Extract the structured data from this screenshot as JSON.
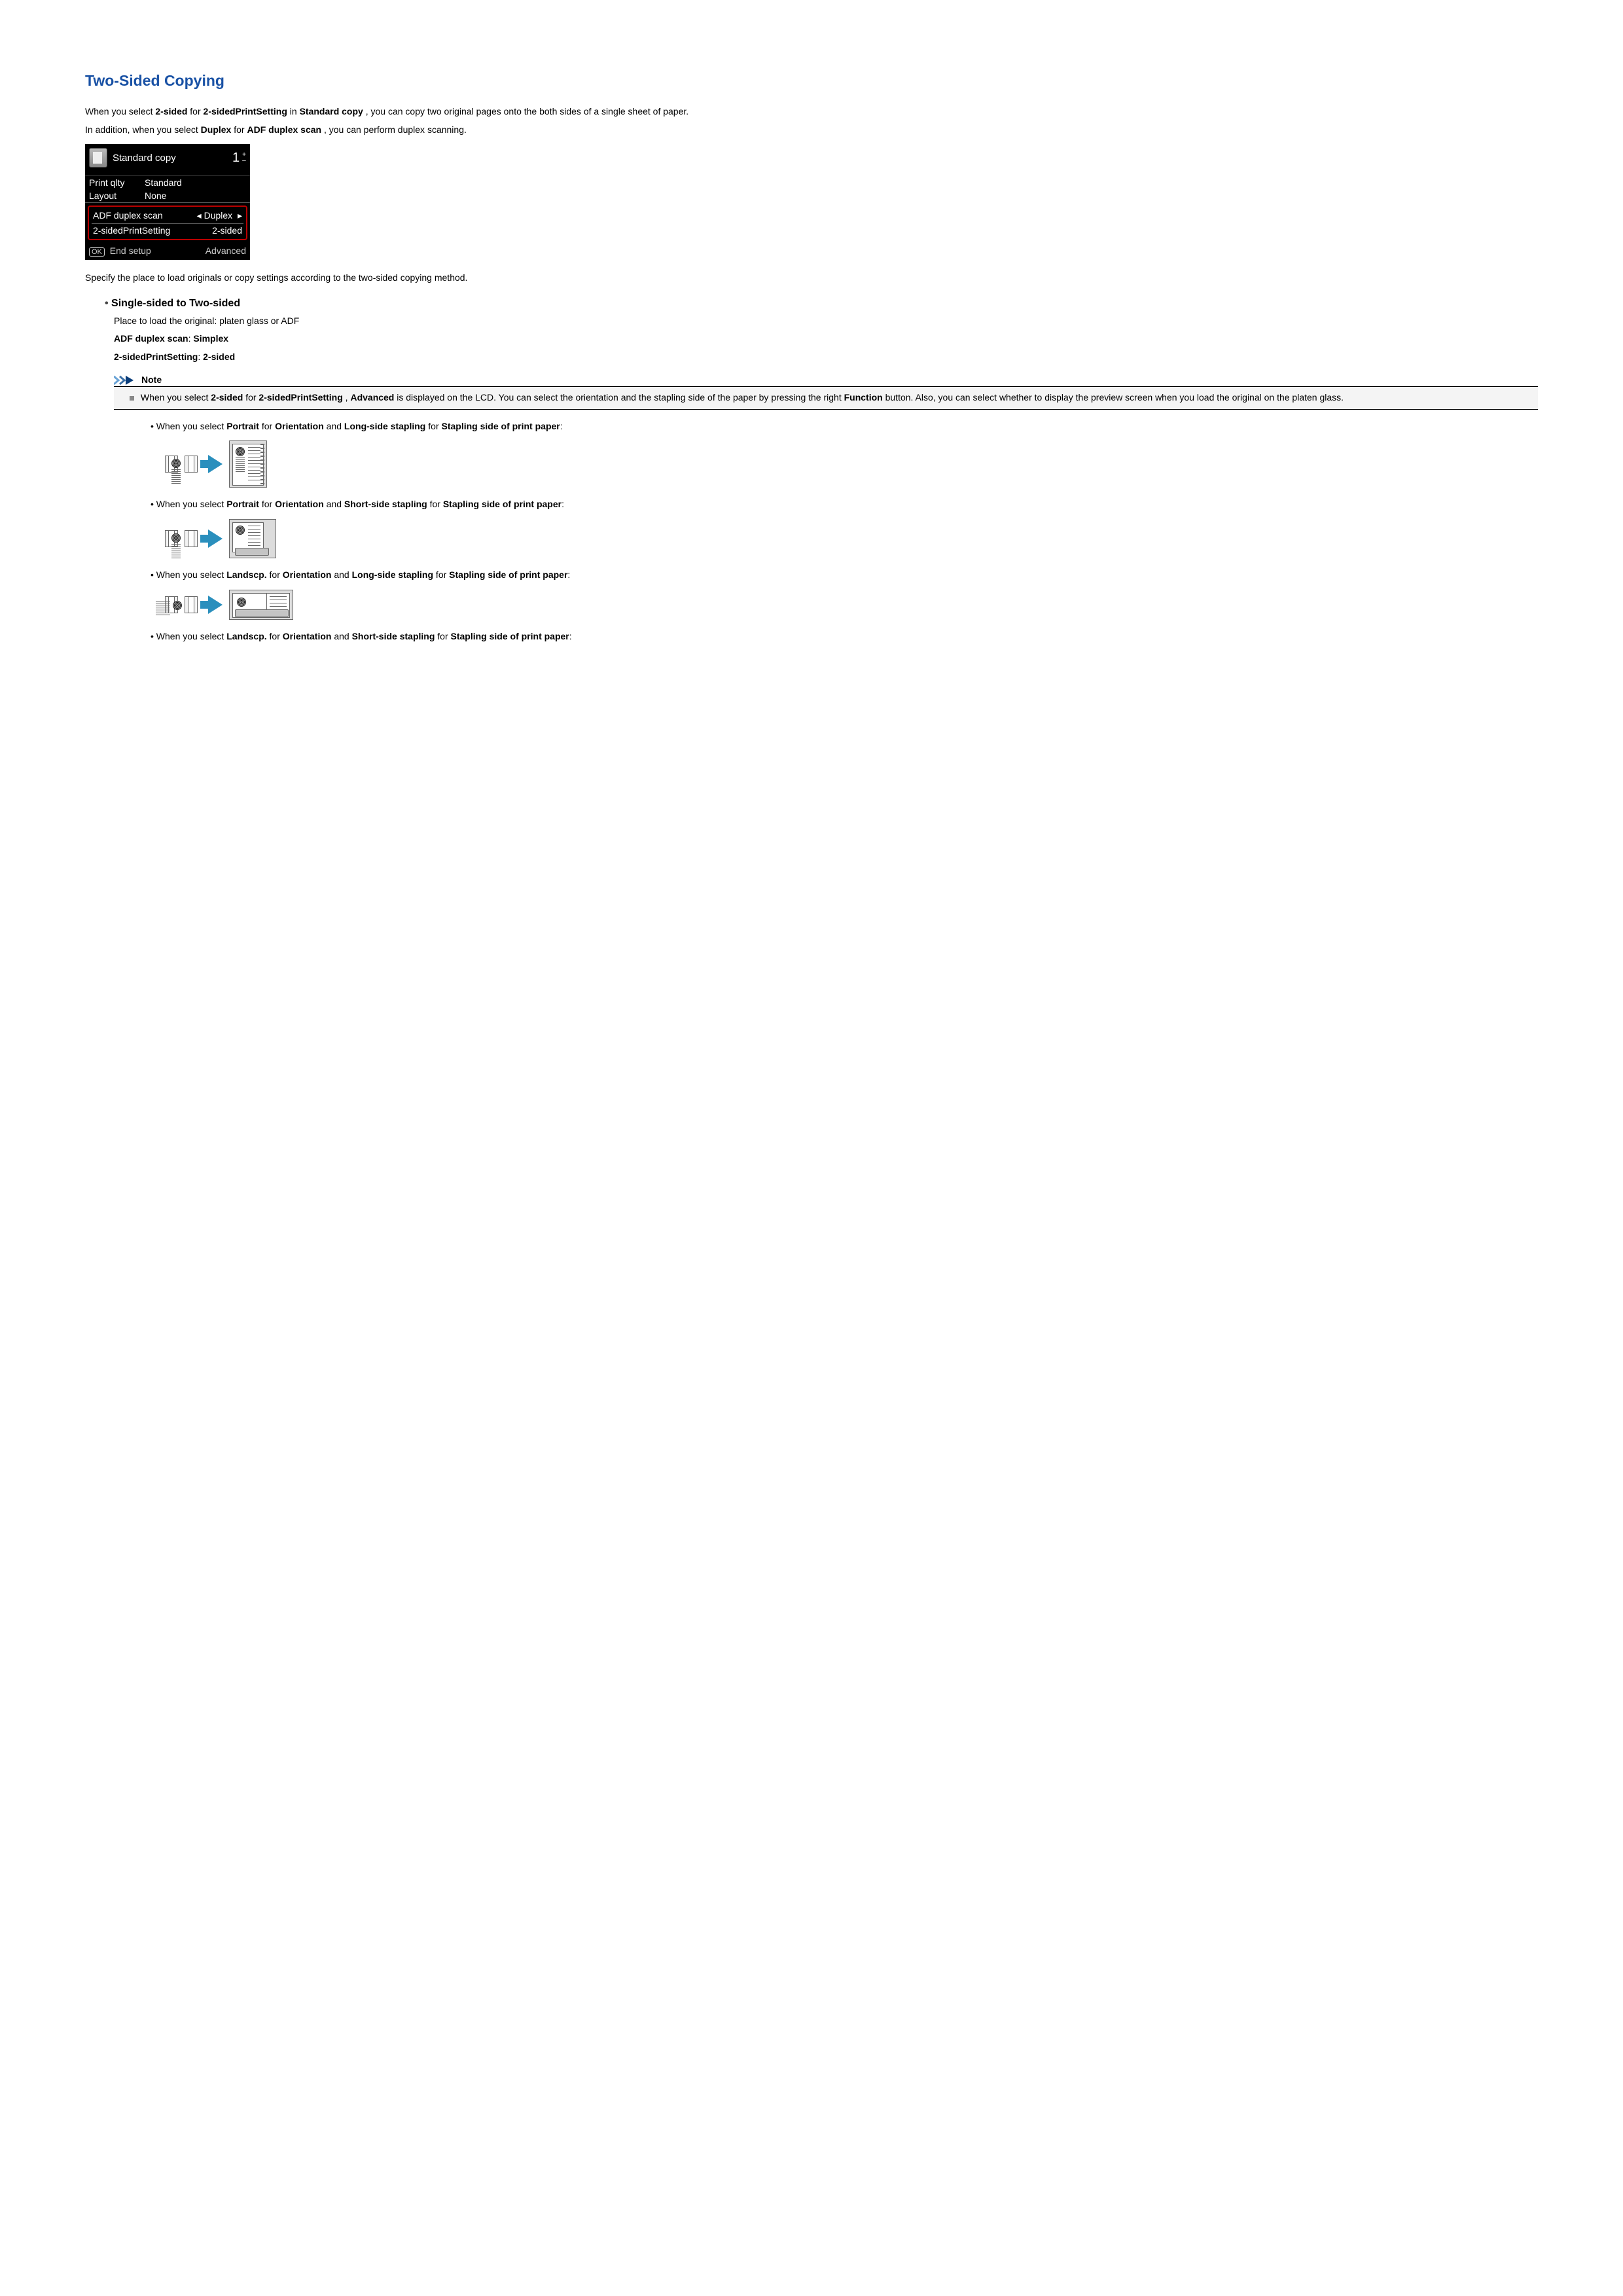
{
  "title": "Two-Sided Copying",
  "intro": {
    "p1_a": "When you select ",
    "p1_b": "2-sided",
    "p1_c": " for ",
    "p1_d": "2-sidedPrintSetting",
    "p1_e": " in ",
    "p1_f": "Standard copy",
    "p1_g": ", you can copy two original pages onto the both sides of a single sheet of paper.",
    "p2_a": "In addition, when you select ",
    "p2_b": "Duplex",
    "p2_c": " for ",
    "p2_d": "ADF duplex scan",
    "p2_e": ", you can perform duplex scanning."
  },
  "lcd": {
    "title": "Standard copy",
    "count": "1",
    "plus": "+",
    "minus": "–",
    "printqlty_k": "Print qlty",
    "printqlty_v": "Standard",
    "layout_k": "Layout",
    "layout_v": "None",
    "adf_k": "ADF duplex scan",
    "adf_v": "Duplex",
    "two_k": "2-sidedPrintSetting",
    "two_v": "2-sided",
    "ok": "OK",
    "end": "End setup",
    "adv": "Advanced"
  },
  "afterlcd": "Specify the place to load originals or copy settings according to the two-sided copying method.",
  "section1": {
    "heading": "Single-sided to Two-sided",
    "place": "Place to load the original: platen glass or ADF",
    "line1a": "ADF duplex scan",
    "line1b": ": ",
    "line1c": "Simplex",
    "line2a": "2-sidedPrintSetting",
    "line2b": ": ",
    "line2c": "2-sided"
  },
  "note": {
    "title": "Note",
    "t1": "When you select ",
    "t2": "2-sided",
    "t3": " for ",
    "t4": "2-sidedPrintSetting",
    "t5": ", ",
    "t6": "Advanced",
    "t7": " is displayed on the LCD. You can select the orientation and the stapling side of the paper by pressing the right ",
    "t8": "Function",
    "t9": " button. Also, you can select whether to display the preview screen when you load the original on the platen glass."
  },
  "opts": {
    "o1a": "When you select ",
    "o1b": "Portrait",
    "o1c": " for ",
    "o1d": "Orientation",
    "o1e": " and ",
    "o1f": "Long-side stapling",
    "o1g": " for ",
    "o1h": "Stapling side of print paper",
    "o1i": ":",
    "o2a": "When you select ",
    "o2b": "Portrait",
    "o2c": " for ",
    "o2d": "Orientation",
    "o2e": " and ",
    "o2f": "Short-side stapling",
    "o2g": " for ",
    "o2h": "Stapling side of print paper",
    "o2i": ":",
    "o3a": "When you select ",
    "o3b": "Landscp.",
    "o3c": " for ",
    "o3d": "Orientation",
    "o3e": " and ",
    "o3f": "Long-side stapling",
    "o3g": " for ",
    "o3h": "Stapling side of print paper",
    "o3i": ":",
    "o4a": "When you select ",
    "o4b": "Landscp.",
    "o4c": " for ",
    "o4d": "Orientation",
    "o4e": " and ",
    "o4f": "Short-side stapling",
    "o4g": " for ",
    "o4h": "Stapling side of print paper",
    "o4i": ":"
  }
}
